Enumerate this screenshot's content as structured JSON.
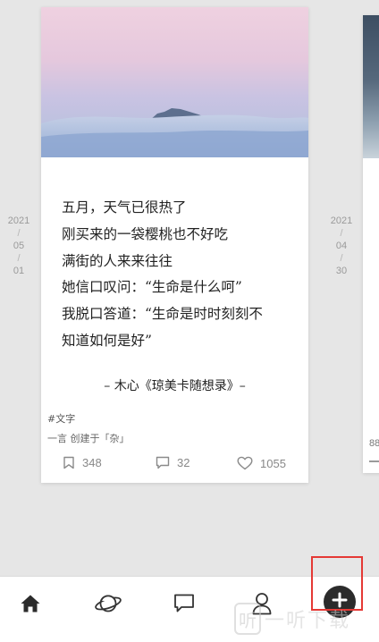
{
  "dates": {
    "left": {
      "year": "2021",
      "month": "05",
      "day": "01",
      "separator": "/"
    },
    "right": {
      "year": "2021",
      "month": "04",
      "day": "30",
      "separator": "/"
    }
  },
  "card": {
    "poem_lines": [
      "五月，天气已很热了",
      "刚买来的一袋樱桃也不好吃",
      "满街的人来来往往",
      "她信口叹问：“生命是什么呵”",
      "我脱口答道：“生命是时时刻刻不",
      "知道如何是好”"
    ],
    "attribution": "– 木心《琼美卡随想录》–",
    "tag": "#文字",
    "meta": "一言 创建于「杂」",
    "stats": {
      "bookmarks": "348",
      "comments": "32",
      "likes": "1055"
    }
  },
  "right_card": {
    "partial_count": "88"
  },
  "nav": {
    "items": [
      {
        "icon": "home-icon"
      },
      {
        "icon": "planet-icon"
      },
      {
        "icon": "chat-bubble-icon"
      },
      {
        "icon": "person-icon"
      },
      {
        "icon": "plus-icon"
      }
    ]
  },
  "watermark": {
    "logo_glyph": "听",
    "text": "一听下载"
  },
  "colors": {
    "highlight": "#e53935",
    "add_button": "#2b2b2b",
    "background": "#e6e6e6"
  }
}
